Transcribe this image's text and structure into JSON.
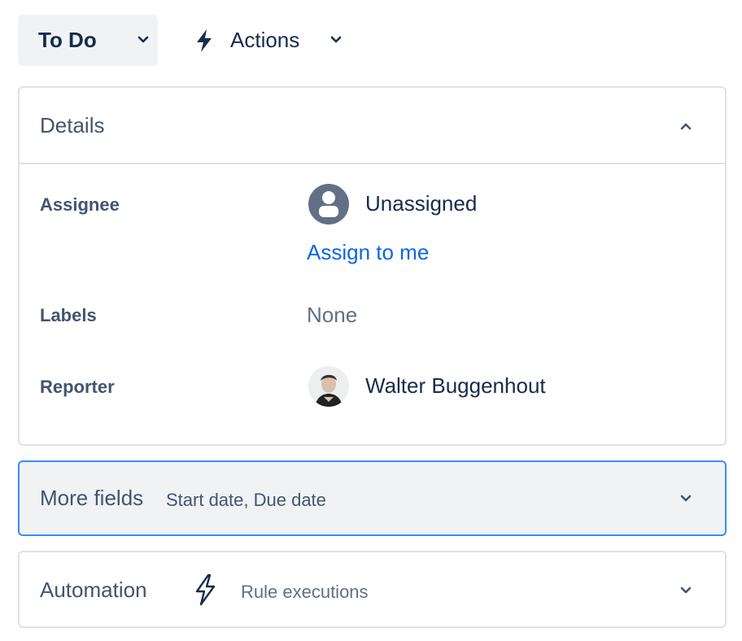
{
  "toolbar": {
    "status_label": "To Do",
    "actions_label": "Actions"
  },
  "details": {
    "title": "Details",
    "fields": [
      {
        "label": "Assignee",
        "value": "Unassigned",
        "link": "Assign to me"
      },
      {
        "label": "Labels",
        "value": "None"
      },
      {
        "label": "Reporter",
        "value": "Walter Buggenhout"
      }
    ]
  },
  "more_fields": {
    "title": "More fields",
    "subtitle": "Start date, Due date"
  },
  "automation": {
    "title": "Automation",
    "subtitle": "Rule executions"
  },
  "colors": {
    "text": "#172b4d",
    "subtle_text": "#44546f",
    "link": "#0c66e4",
    "focus_border": "#388bff",
    "neutral_bg": "#f1f2f4"
  }
}
